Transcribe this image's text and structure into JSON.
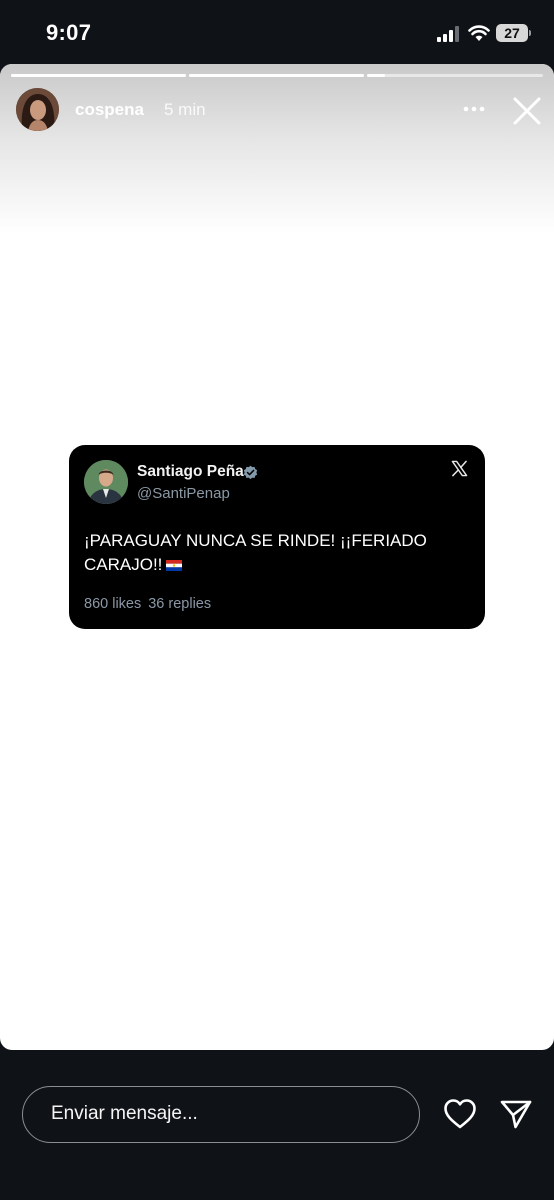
{
  "status_bar": {
    "time": "9:07",
    "battery": "27"
  },
  "story": {
    "username": "cospena",
    "time_ago": "5 min",
    "progress": [
      1.0,
      1.0,
      0.1
    ]
  },
  "tweet": {
    "name": "Santiago Peña",
    "handle": "@SantiPenap",
    "text": "¡PARAGUAY NUNCA SE RINDE! ¡¡FERIADO CARAJO!!",
    "likes": "860 likes",
    "replies": "36 replies"
  },
  "composer": {
    "placeholder": "Enviar mensaje..."
  }
}
